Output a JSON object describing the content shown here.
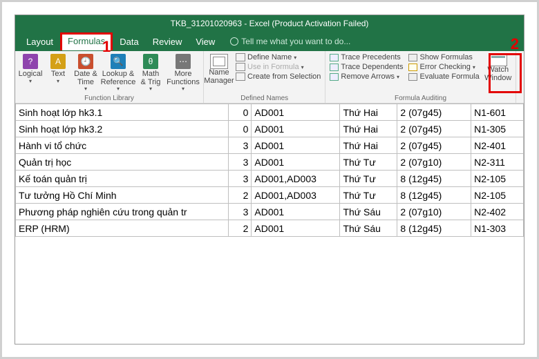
{
  "title": "TKB_31201020963 - Excel (Product Activation Failed)",
  "tabs": {
    "layout": "Layout",
    "formulas": "Formulas",
    "data": "Data",
    "review": "Review",
    "view": "View",
    "tell_me": "Tell me what you want to do..."
  },
  "annotations": {
    "one": "1",
    "two": "2"
  },
  "ribbon": {
    "fn_library": {
      "label": "Function Library",
      "logical": "Logical",
      "text": "Text",
      "date": "Date & Time",
      "lookup": "Lookup & Reference",
      "math": "Math & Trig",
      "more": "More Functions"
    },
    "defined_names": {
      "label": "Defined Names",
      "name_mgr": "Name Manager",
      "define": "Define Name",
      "use": "Use in Formula",
      "create": "Create from Selection"
    },
    "auditing": {
      "label": "Formula Auditing",
      "precedents": "Trace Precedents",
      "dependents": "Trace Dependents",
      "remove": "Remove Arrows",
      "show_formulas": "Show Formulas",
      "error_check": "Error Checking",
      "evaluate": "Evaluate Formula",
      "watch": "Watch Window"
    }
  },
  "rows": [
    {
      "a": "Sinh hoạt lớp hk3.1",
      "b": "0",
      "c": "AD001",
      "d": "Thứ Hai",
      "e": "2 (07g45)",
      "f": "N1-601"
    },
    {
      "a": "Sinh hoạt lớp hk3.2",
      "b": "0",
      "c": "AD001",
      "d": "Thứ Hai",
      "e": "2 (07g45)",
      "f": "N1-305"
    },
    {
      "a": "Hành vi tổ chức",
      "b": "3",
      "c": "AD001",
      "d": "Thứ Hai",
      "e": "2 (07g45)",
      "f": "N2-401"
    },
    {
      "a": "Quản trị học",
      "b": "3",
      "c": "AD001",
      "d": "Thứ Tư",
      "e": "2 (07g10)",
      "f": "N2-311"
    },
    {
      "a": "Kế toán quản trị",
      "b": "3",
      "c": "AD001,AD003",
      "d": "Thứ Tư",
      "e": "8 (12g45)",
      "f": "N2-105"
    },
    {
      "a": "Tư tưởng Hồ Chí Minh",
      "b": "2",
      "c": "AD001,AD003",
      "d": "Thứ Tư",
      "e": "8 (12g45)",
      "f": "N2-105"
    },
    {
      "a": "Phương pháp nghiên cứu trong quản tr",
      "b": "3",
      "c": "AD001",
      "d": "Thứ Sáu",
      "e": "2 (07g10)",
      "f": "N2-402"
    },
    {
      "a": "ERP (HRM)",
      "b": "2",
      "c": "AD001",
      "d": "Thứ Sáu",
      "e": "8 (12g45)",
      "f": "N1-303"
    }
  ]
}
